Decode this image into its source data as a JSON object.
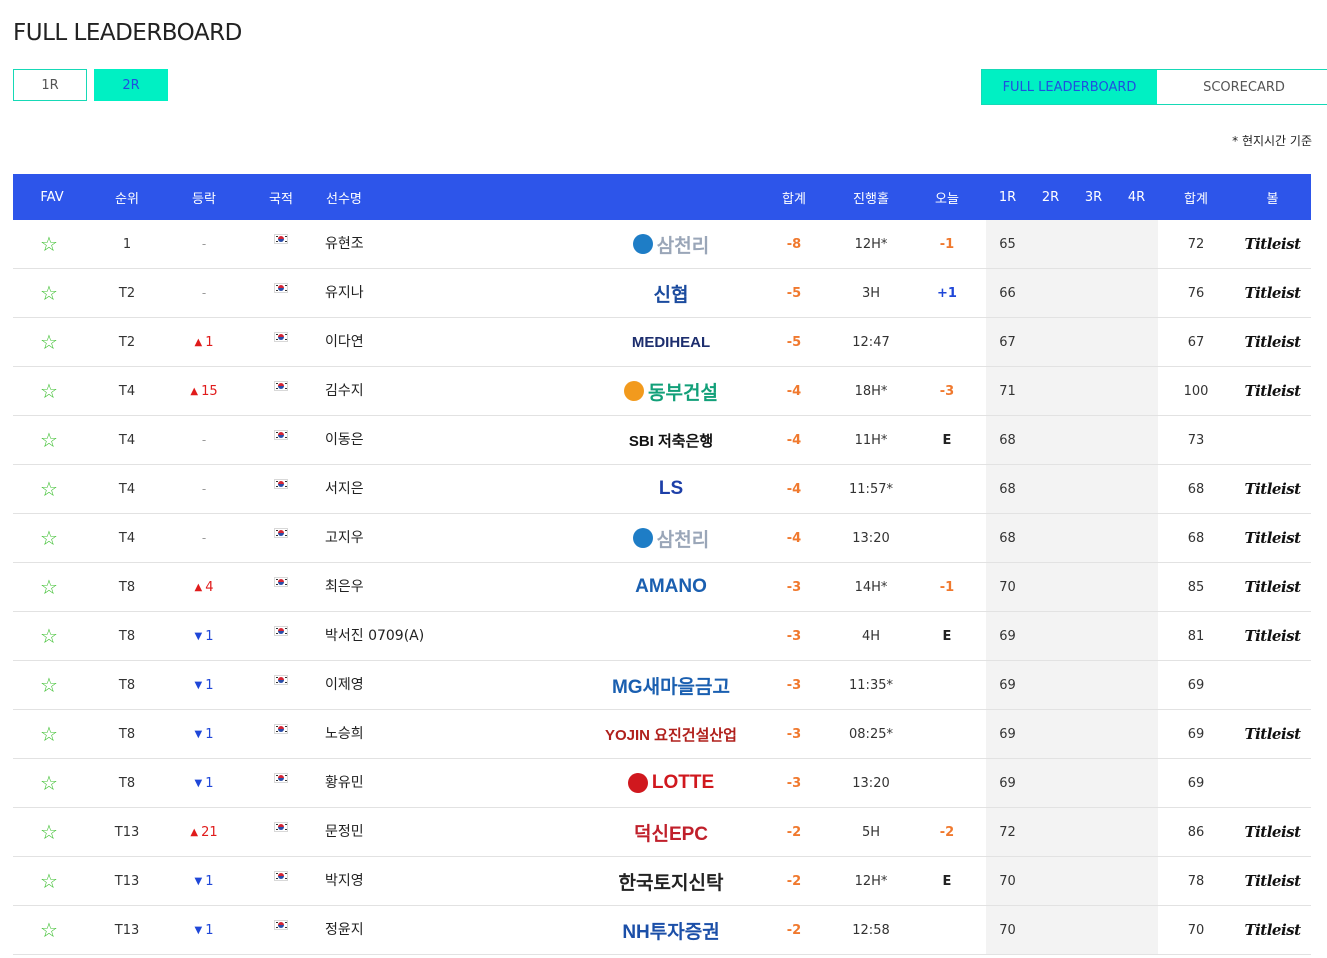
{
  "page": {
    "title": "FULL LEADERBOARD",
    "note": "* 현지시간 기준"
  },
  "round_tabs": [
    {
      "label": "1R",
      "active": false
    },
    {
      "label": "2R",
      "active": true
    }
  ],
  "view_tabs": [
    {
      "label": "FULL LEADERBOARD",
      "active": true
    },
    {
      "label": "SCORECARD",
      "active": false
    }
  ],
  "colors": {
    "header_bg": "#2d55ea",
    "accent": "#00f0c3",
    "score": "#f0792e",
    "up": "#e01b1b",
    "down": "#1f47d8",
    "star": "#3bbf2e"
  },
  "columns": {
    "fav": "FAV",
    "rank": "순위",
    "move": "등락",
    "nation": "국적",
    "name": "선수명",
    "total": "합계",
    "thru": "진행홀",
    "today": "오늘",
    "r1": "1R",
    "r2": "2R",
    "r3": "3R",
    "r4": "4R",
    "sum": "합계",
    "ball": "볼"
  },
  "rows": [
    {
      "rank": "1",
      "move_dir": "none",
      "move": "-",
      "flag": "korea-flag-icon",
      "name": "유현조",
      "sponsor": "삼천리",
      "sponsor_icon": "samchully-logo",
      "total": "-8",
      "thru": "12H*",
      "today": "-1",
      "r1": "65",
      "sum": "72",
      "ball": "Titleist"
    },
    {
      "rank": "T2",
      "move_dir": "none",
      "move": "-",
      "flag": "korea-flag-icon",
      "name": "유지나",
      "sponsor": "신협",
      "sponsor_icon": "shinhyup-logo",
      "total": "-5",
      "thru": "3H",
      "today": "+1",
      "r1": "66",
      "sum": "76",
      "ball": "Titleist"
    },
    {
      "rank": "T2",
      "move_dir": "up",
      "move": "1",
      "flag": "korea-flag-icon",
      "name": "이다연",
      "sponsor": "MEDIHEAL",
      "sponsor_icon": "",
      "total": "-5",
      "thru": "12:47",
      "today": "",
      "r1": "67",
      "sum": "67",
      "ball": "Titleist"
    },
    {
      "rank": "T4",
      "move_dir": "up",
      "move": "15",
      "flag": "korea-flag-icon",
      "name": "김수지",
      "sponsor": "동부건설",
      "sponsor_icon": "dongbu-logo",
      "total": "-4",
      "thru": "18H*",
      "today": "-3",
      "r1": "71",
      "sum": "100",
      "ball": "Titleist"
    },
    {
      "rank": "T4",
      "move_dir": "none",
      "move": "-",
      "flag": "korea-flag-icon",
      "name": "이동은",
      "sponsor": "SBI 저축은행",
      "sponsor_icon": "",
      "total": "-4",
      "thru": "11H*",
      "today": "E",
      "r1": "68",
      "sum": "73",
      "ball": ""
    },
    {
      "rank": "T4",
      "move_dir": "none",
      "move": "-",
      "flag": "korea-flag-icon",
      "name": "서지은",
      "sponsor": "LS",
      "sponsor_icon": "",
      "total": "-4",
      "thru": "11:57*",
      "today": "",
      "r1": "68",
      "sum": "68",
      "ball": "Titleist"
    },
    {
      "rank": "T4",
      "move_dir": "none",
      "move": "-",
      "flag": "korea-flag-icon",
      "name": "고지우",
      "sponsor": "삼천리",
      "sponsor_icon": "samchully-logo",
      "total": "-4",
      "thru": "13:20",
      "today": "",
      "r1": "68",
      "sum": "68",
      "ball": "Titleist"
    },
    {
      "rank": "T8",
      "move_dir": "up",
      "move": "4",
      "flag": "korea-flag-icon",
      "name": "최은우",
      "sponsor": "AMANO",
      "sponsor_icon": "amano-logo",
      "total": "-3",
      "thru": "14H*",
      "today": "-1",
      "r1": "70",
      "sum": "85",
      "ball": "Titleist"
    },
    {
      "rank": "T8",
      "move_dir": "down",
      "move": "1",
      "flag": "korea-flag-icon",
      "name": "박서진 0709(A)",
      "sponsor": "",
      "sponsor_icon": "",
      "total": "-3",
      "thru": "4H",
      "today": "E",
      "r1": "69",
      "sum": "81",
      "ball": "Titleist"
    },
    {
      "rank": "T8",
      "move_dir": "down",
      "move": "1",
      "flag": "korea-flag-icon",
      "name": "이제영",
      "sponsor": "MG새마을금고",
      "sponsor_icon": "mg-logo",
      "total": "-3",
      "thru": "11:35*",
      "today": "",
      "r1": "69",
      "sum": "69",
      "ball": ""
    },
    {
      "rank": "T8",
      "move_dir": "down",
      "move": "1",
      "flag": "korea-flag-icon",
      "name": "노승희",
      "sponsor": "YOJIN 요진건설산업",
      "sponsor_icon": "",
      "total": "-3",
      "thru": "08:25*",
      "today": "",
      "r1": "69",
      "sum": "69",
      "ball": "Titleist"
    },
    {
      "rank": "T8",
      "move_dir": "down",
      "move": "1",
      "flag": "korea-flag-icon",
      "name": "황유민",
      "sponsor": "LOTTE",
      "sponsor_icon": "lotte-logo",
      "total": "-3",
      "thru": "13:20",
      "today": "",
      "r1": "69",
      "sum": "69",
      "ball": ""
    },
    {
      "rank": "T13",
      "move_dir": "up",
      "move": "21",
      "flag": "korea-flag-icon",
      "name": "문정민",
      "sponsor": "덕신EPC",
      "sponsor_icon": "deokshin-logo",
      "total": "-2",
      "thru": "5H",
      "today": "-2",
      "r1": "72",
      "sum": "86",
      "ball": "Titleist"
    },
    {
      "rank": "T13",
      "move_dir": "down",
      "move": "1",
      "flag": "korea-flag-icon",
      "name": "박지영",
      "sponsor": "한국토지신탁",
      "sponsor_icon": "kreit-logo",
      "total": "-2",
      "thru": "12H*",
      "today": "E",
      "r1": "70",
      "sum": "78",
      "ball": "Titleist"
    },
    {
      "rank": "T13",
      "move_dir": "down",
      "move": "1",
      "flag": "korea-flag-icon",
      "name": "정윤지",
      "sponsor": "NH투자증권",
      "sponsor_icon": "nh-logo",
      "total": "-2",
      "thru": "12:58",
      "today": "",
      "r1": "70",
      "sum": "70",
      "ball": "Titleist"
    }
  ]
}
